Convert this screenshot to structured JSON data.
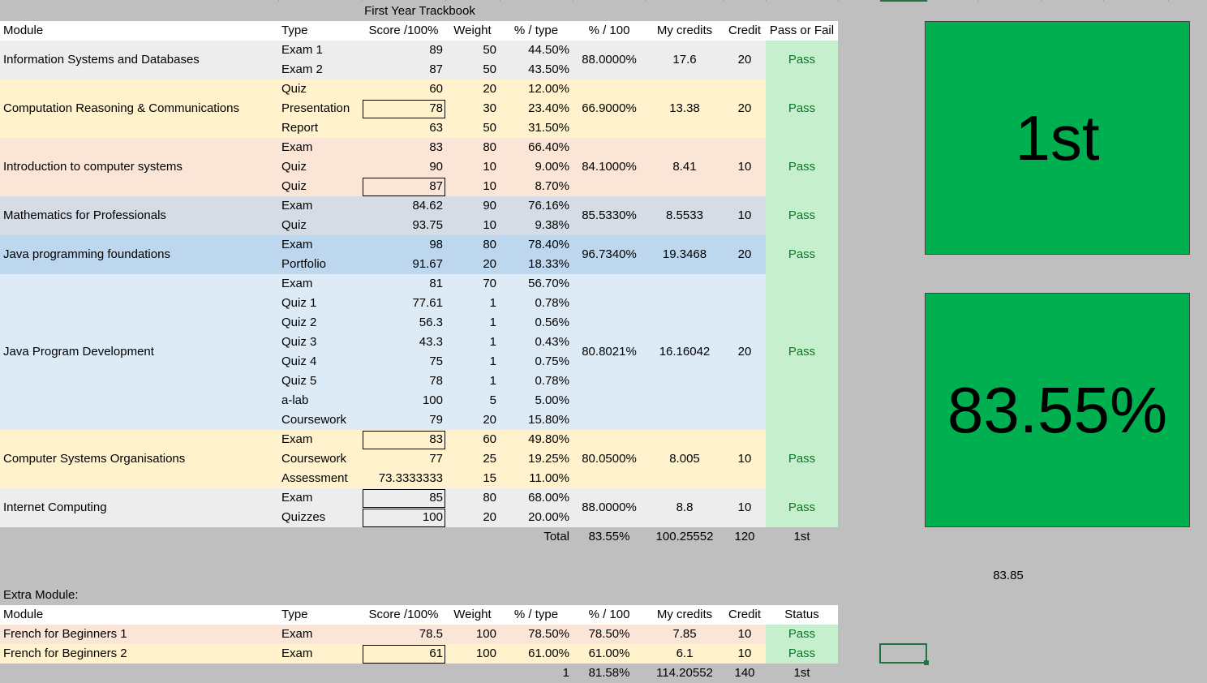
{
  "title": "First Year Trackbook",
  "headers": [
    "Module",
    "Type",
    "Score /100%",
    "Weight",
    "% / type",
    "% / 100",
    "My credits",
    "Credit",
    "Pass or Fail"
  ],
  "modules": [
    {
      "name": "Information Systems and Databases",
      "pct100": "88.0000%",
      "my_credits": "17.6",
      "credit": "20",
      "result": "Pass",
      "rows": [
        [
          "Exam 1",
          "89",
          "50",
          "44.50%"
        ],
        [
          "Exam 2",
          "87",
          "50",
          "43.50%"
        ]
      ]
    },
    {
      "name": "Computation Reasoning & Communications",
      "pct100": "66.9000%",
      "my_credits": "13.38",
      "credit": "20",
      "result": "Pass",
      "rows": [
        [
          "Quiz",
          "60",
          "20",
          "12.00%"
        ],
        [
          "Presentation",
          "78",
          "30",
          "23.40%"
        ],
        [
          "Report",
          "63",
          "50",
          "31.50%"
        ]
      ]
    },
    {
      "name": "Introduction to computer systems",
      "pct100": "84.1000%",
      "my_credits": "8.41",
      "credit": "10",
      "result": "Pass",
      "rows": [
        [
          "Exam",
          "83",
          "80",
          "66.40%"
        ],
        [
          "Quiz",
          "90",
          "10",
          "9.00%"
        ],
        [
          "Quiz",
          "87",
          "10",
          "8.70%"
        ]
      ]
    },
    {
      "name": "Mathematics for Professionals",
      "pct100": "85.5330%",
      "my_credits": "8.5533",
      "credit": "10",
      "result": "Pass",
      "rows": [
        [
          "Exam",
          "84.62",
          "90",
          "76.16%"
        ],
        [
          "Quiz",
          "93.75",
          "10",
          "9.38%"
        ]
      ]
    },
    {
      "name": "Java programming foundations",
      "pct100": "96.7340%",
      "my_credits": "19.3468",
      "credit": "20",
      "result": "Pass",
      "rows": [
        [
          "Exam",
          "98",
          "80",
          "78.40%"
        ],
        [
          "Portfolio",
          "91.67",
          "20",
          "18.33%"
        ]
      ]
    },
    {
      "name": "Java Program Development",
      "pct100": "80.8021%",
      "my_credits": "16.16042",
      "credit": "20",
      "result": "Pass",
      "rows": [
        [
          "Exam",
          "81",
          "70",
          "56.70%"
        ],
        [
          "Quiz 1",
          "77.61",
          "1",
          "0.78%"
        ],
        [
          "Quiz 2",
          "56.3",
          "1",
          "0.56%"
        ],
        [
          "Quiz 3",
          "43.3",
          "1",
          "0.43%"
        ],
        [
          "Quiz 4",
          "75",
          "1",
          "0.75%"
        ],
        [
          "Quiz 5",
          "78",
          "1",
          "0.78%"
        ],
        [
          "a-lab",
          "100",
          "5",
          "5.00%"
        ],
        [
          "Coursework",
          "79",
          "20",
          "15.80%"
        ]
      ]
    },
    {
      "name": "Computer Systems Organisations",
      "pct100": "80.0500%",
      "my_credits": "8.005",
      "credit": "10",
      "result": "Pass",
      "rows": [
        [
          "Exam",
          "83",
          "60",
          "49.80%"
        ],
        [
          "Coursework",
          "77",
          "25",
          "19.25%"
        ],
        [
          "Assessment",
          "73.3333333",
          "15",
          "11.00%"
        ]
      ]
    },
    {
      "name": "Internet Computing",
      "pct100": "88.0000%",
      "my_credits": "8.8",
      "credit": "10",
      "result": "Pass",
      "rows": [
        [
          "Exam",
          "85",
          "80",
          "68.00%"
        ],
        [
          "Quizzes",
          "100",
          "20",
          "20.00%"
        ]
      ]
    }
  ],
  "totals": {
    "label": "Total",
    "pct100": "83.55%",
    "my_credits": "100.25552",
    "credit": "120",
    "result": "1st"
  },
  "grade_box": "1st",
  "percent_box": "83.55%",
  "side_value": "83.85",
  "extra": {
    "label": "Extra Module:",
    "headers": [
      "Module",
      "Type",
      "Score /100%",
      "Weight",
      "% / type",
      "% / 100",
      "My credits",
      "Credit",
      "Status"
    ],
    "rows": [
      [
        "French for Beginners 1",
        "Exam",
        "78.5",
        "100",
        "78.50%",
        "78.50%",
        "7.85",
        "10",
        "Pass"
      ],
      [
        "French for Beginners 2",
        "Exam",
        "61",
        "100",
        "61.00%",
        "61.00%",
        "6.1",
        "10",
        "Pass"
      ]
    ],
    "totals": {
      "weight": "1",
      "pct100": "81.58%",
      "my_credits": "114.20552",
      "credit": "140",
      "result": "1st"
    }
  },
  "colors": {
    "pass_text": "#0a7a22",
    "pass_bg": "#c6efce",
    "box_green": "#00b050"
  }
}
